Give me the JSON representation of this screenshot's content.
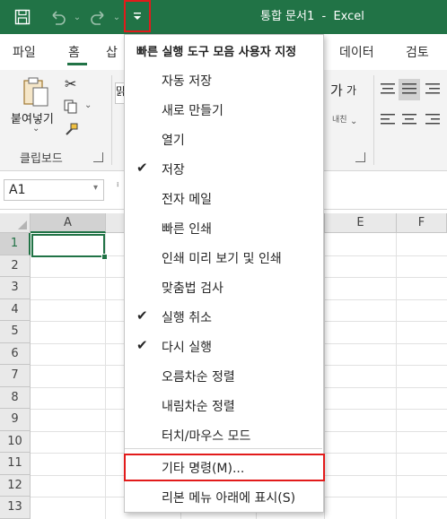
{
  "app": {
    "doc_title": "통합 문서1  -  Excel",
    "accent": "#217346",
    "highlight": "#e21b1b"
  },
  "tabs": [
    "파일",
    "홈",
    "삽",
    "데이터",
    "검토"
  ],
  "ribbon": {
    "paste_label": "붙여넣기",
    "clipboard_group": "클립보드",
    "font_size_up": "가",
    "font_size_down": "가",
    "wrap_label": "내친",
    "font_box_partial": "맑"
  },
  "namebox": {
    "value": "A1"
  },
  "grid": {
    "columns": [
      "A",
      "",
      "",
      "",
      "E",
      "F"
    ],
    "rows": [
      "1",
      "2",
      "3",
      "4",
      "5",
      "6",
      "7",
      "8",
      "9",
      "10",
      "11",
      "12",
      "13"
    ]
  },
  "menu": {
    "title": "빠른 실행 도구 모음 사용자 지정",
    "items": [
      {
        "label": "자동 저장",
        "checked": false
      },
      {
        "label": "새로 만들기",
        "checked": false
      },
      {
        "label": "열기",
        "checked": false
      },
      {
        "label": "저장",
        "checked": true
      },
      {
        "label": "전자 메일",
        "checked": false
      },
      {
        "label": "빠른 인쇄",
        "checked": false
      },
      {
        "label": "인쇄 미리 보기 및 인쇄",
        "checked": false
      },
      {
        "label": "맞춤법 검사",
        "checked": false
      },
      {
        "label": "실행 취소",
        "checked": true
      },
      {
        "label": "다시 실행",
        "checked": true
      },
      {
        "label": "오름차순 정렬",
        "checked": false
      },
      {
        "label": "내림차순 정렬",
        "checked": false
      },
      {
        "label": "터치/마우스 모드",
        "checked": false
      }
    ],
    "more_commands": "기타 명령(M)...",
    "show_below_ribbon": "리본 메뉴 아래에 표시(S)",
    "check_glyph": "✔"
  }
}
